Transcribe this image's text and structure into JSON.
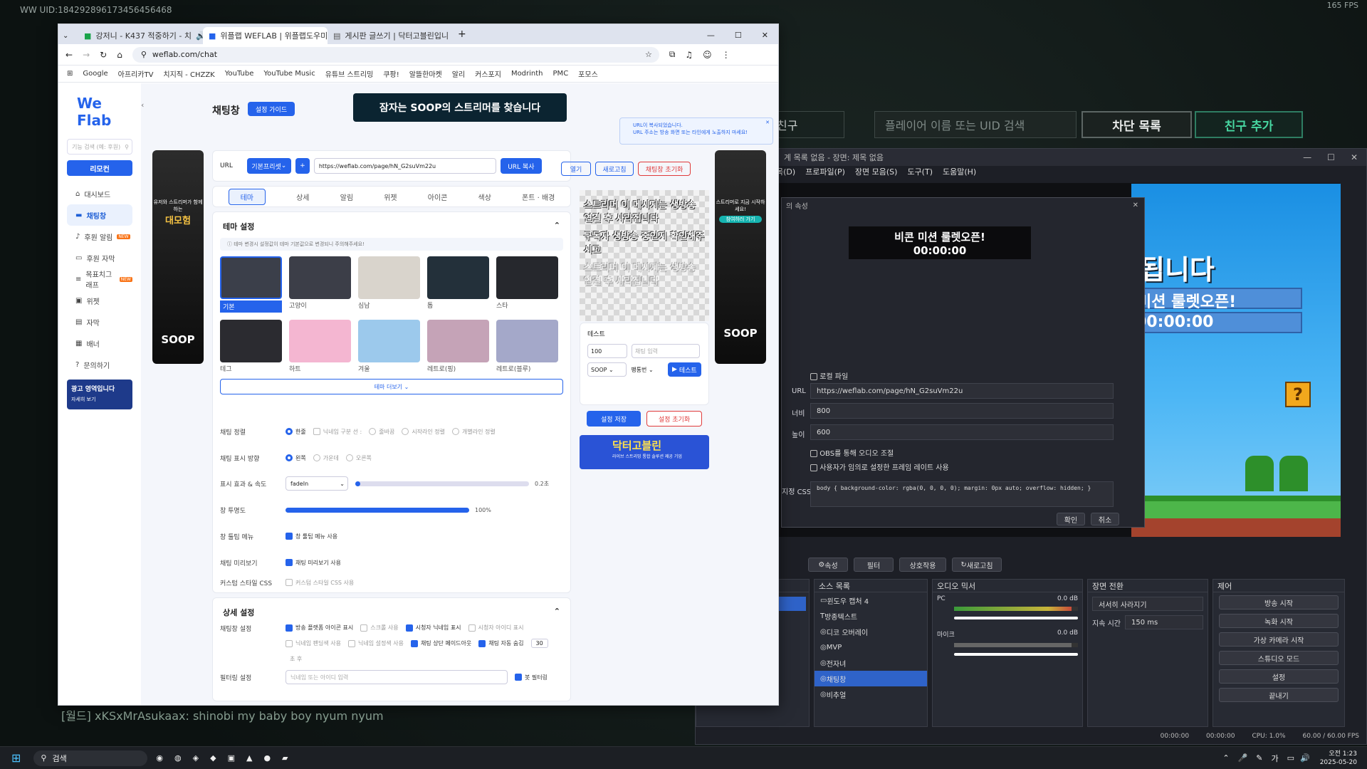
{
  "game": {
    "uid": "WW UID:1842928961734564564​68",
    "fps": "165 FPS",
    "friends_partial": "친구",
    "search_placeholder": "플레이어 이름 또는 UID 검색",
    "block_list": "차단 목록",
    "add_friend": "친구 추가",
    "chat_line": "[월드] xKSxMrAsukaax: shinobi my baby boy nyum nyum"
  },
  "chrome": {
    "tabs": [
      "강저니 - K437 적중하기 - 치",
      "위플랩 WEFLAB | 위플랩도우미",
      "게시판 글쓰기 | 닥터고블린입니"
    ],
    "url": "weflab.com/chat",
    "bookmarks": [
      "Google",
      "아프리카TV",
      "치지직 - CHZZK",
      "YouTube",
      "YouTube Music",
      "유튜브 스트리밍",
      "쿠팡!",
      "알뜰한마켓",
      "알리",
      "커스포지",
      "Modrinth",
      "PMC",
      "포모스"
    ]
  },
  "weflab": {
    "logo": "We Flab",
    "search_placeholder": "기능 검색 (예: 후원)",
    "remote_btn": "리모컨",
    "nav": [
      "대시보드",
      "채팅창",
      "후원 알림",
      "후원 자막",
      "목표치그래프",
      "위젯",
      "자막",
      "배너",
      "문의하기"
    ],
    "nav_new": "NEW",
    "ad_box": {
      "title": "광고 영역입니다",
      "link": "자세히 보기"
    },
    "page_title": "채팅창",
    "guide_btn": "설정 가이드",
    "banner_text": "잠자는 SOOP의 스트리머를 찾습니다",
    "toast": {
      "line1": "URL이 복사되었습니다.",
      "line2": "URL 주소는 방송 화면 또는 타인에게 노출하지 마세요!"
    },
    "url_label": "URL",
    "preset": "기본프리셋",
    "url_value": "https://weflab.com/page/hN_G2suVm22u",
    "copy_btn": "URL 복사",
    "open_btn": "열기",
    "refresh_btn": "새로고침",
    "reset_btn": "채팅창 초기화",
    "subtabs": [
      "테마",
      "상세",
      "알림",
      "위젯",
      "아이콘",
      "색상",
      "폰트 · 배경"
    ],
    "theme_section": "테마 설정",
    "theme_notice": "테마 변경시 설정값이 테마 기본값으로 변경되니 주의해주세요!",
    "themes": [
      "기본",
      "고양이",
      "심남",
      "톱",
      "스타",
      "테그",
      "하트",
      "겨울",
      "레트로(핑)",
      "레트로(블루)"
    ],
    "more_themes": "테마 더보기",
    "align": {
      "label": "채팅 정렬",
      "options": [
        "한줄",
        "닉네임 구분 선 :",
        "줄바꿈",
        "시작라인 정렬",
        "개별라인 정렬"
      ]
    },
    "direction": {
      "label": "채팅 표시 방향",
      "options": [
        "왼쪽",
        "가운데",
        "오른쪽"
      ]
    },
    "effect": {
      "label": "표시 효과 & 속도",
      "value": "fadeIn",
      "speed": "0.2초",
      "speed_fraction": 0.02
    },
    "opacity": {
      "label": "창 투명도",
      "value": "100%",
      "fraction": 1.0
    },
    "tool_menu": {
      "label": "창 툴팁 메뉴",
      "opt": "창 툴팁 메뉴 사용"
    },
    "chat_preview": {
      "label": "채팅 미리보기",
      "opt": "채팅 미리보기 사용"
    },
    "custom_css": {
      "label": "커스텀 스타일 CSS",
      "opt": "커스텀 스타일 CSS 사용"
    },
    "detail_section": "상세 설정",
    "chat_settings_label": "채팅창 설정",
    "chat_opts": [
      "방송 플랫폼 아이콘 표시",
      "스크롤 사용",
      "시청자 닉네임 표시",
      "시청자 아이디 표시",
      "닉네임 팬딩색 사용",
      "닉네임 설정색 사용",
      "채팅 상단 페이드아웃",
      "채팅 자동 숨김"
    ],
    "auto_hide_seconds": "30",
    "seconds_unit": "초 후",
    "filter": {
      "label": "필터링 설정",
      "placeholder": "닉네임 또는 아이디 입력",
      "bot": "봇 필터링"
    },
    "preview_text": [
      "스트리머 이 메시지는 생방송 연결 후 사라집니다",
      "구독자 생방송 중인지 확인해주시고",
      "스트리머 이 메시지는 생방송 연결 후 사라집니다"
    ],
    "test": {
      "label": "테스트",
      "amount": "100",
      "name_placeholder": "채팅 입력",
      "platform": "SOOP",
      "tier": "팽통번",
      "btn": "테스트"
    },
    "save_btn": "설정 저장",
    "reset_settings_btn": "설정 초기화",
    "ad_left": {
      "top": "유저와 스트리머가 함께하는",
      "big": "대모험",
      "brand": "SOOP"
    },
    "ad_right": {
      "top": "스트리머로 지금 시작하세요!",
      "cta": "참여하러 가기",
      "brand": "SOOP"
    },
    "doctor_banner": {
      "title": "닥터고블린",
      "sub": "라이브 스트리밍 통합 솔루션 제공 기업"
    }
  },
  "obs": {
    "title": "계 목록 없음 - 장면: 제목 없음",
    "menu": [
      "목(D)",
      "프로파일(P)",
      "장면 모음(S)",
      "도구(T)",
      "도움말(H)"
    ],
    "dlg_title": "의 속성",
    "overlay": {
      "line1": "비콘 미션 룰렛오픈!",
      "line2": "00:00:00"
    },
    "scene": {
      "big": "됩니다",
      "line1": "미션 룰렛오픈!",
      "line2": "00:00:00",
      "qblock": "?"
    },
    "local_file": "로컬 파일",
    "url_label": "URL",
    "url": "https://weflab.com/page/hN_G2suVm22u",
    "width_label": "너비",
    "width": "800",
    "height_label": "높이",
    "height": "600",
    "obs_audio": "OBS를 통해 오디오 조절",
    "custom_fps": "사용자가 임의로 설정한 프레임 레이트 사용",
    "css_label": "지정 CSS",
    "css": "body { background-color: rgba(0, 0, 0, 0); margin: 0px auto; overflow: hidden; }",
    "ok": "확인",
    "cancel": "취소",
    "toolbar": [
      "속성",
      "필터",
      "상호작용",
      "새로고침"
    ],
    "sources_title": "소스 목록",
    "sources": [
      "윈도우 캡처 4",
      "방종텍스트",
      "디코 오버레이",
      "MVP",
      "전자녀",
      "채팅창",
      "비추얼"
    ],
    "mixer_title": "오디오 믹서",
    "mixer": [
      {
        "name": "PC",
        "db": "0.0 dB",
        "level": 0.95
      },
      {
        "name": "마이크",
        "db": "0.0 dB",
        "level": 0.95
      }
    ],
    "transition_title": "장면 전환",
    "transition": "서서히 사라지기",
    "duration_label": "지속 시간",
    "duration": "150 ms",
    "controls_title": "제어",
    "controls": [
      "방송 시작",
      "녹화 시작",
      "가상 카메라 시작",
      "스튜디오 모드",
      "설정",
      "끝내기"
    ],
    "status": {
      "t1": "00:00:00",
      "t2": "00:00:00",
      "cpu": "CPU: 1.0%",
      "fps": "60.00 / 60.00 FPS"
    }
  },
  "taskbar": {
    "search": "검색",
    "time": "오전 1:23",
    "date": "2025-05-20",
    "ime": "가"
  }
}
